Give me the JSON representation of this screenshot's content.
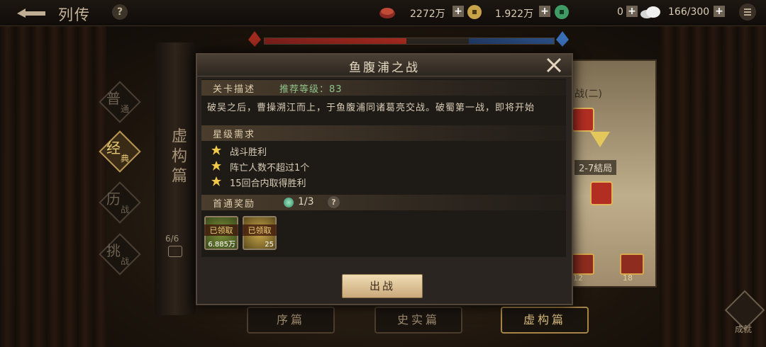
{
  "topbar": {
    "title": "列传",
    "help": "?",
    "copper": "2272万",
    "jade": "1.922万",
    "gems": "0",
    "stamina": "166/300"
  },
  "colors": {
    "accent": "#e7c875",
    "panel": "#2a2520",
    "button": "#e6cfa2"
  },
  "scroll": {
    "title": "虚构篇",
    "count": "6/6"
  },
  "categories": [
    {
      "t1": "普",
      "t2": "通"
    },
    {
      "t1": "经",
      "t2": "典"
    },
    {
      "t1": "历",
      "t2": "战"
    },
    {
      "t1": "挑",
      "t2": "战"
    }
  ],
  "map": {
    "title": "战(二)",
    "stage": "2-7結局",
    "chest1": "12",
    "chest2": "18"
  },
  "tabs": [
    "序篇",
    "史实篇",
    "虚构篇"
  ],
  "achievement": "成就",
  "dialog": {
    "title": "鱼腹浦之战",
    "desc_label": "关卡描述",
    "recommend": "推荐等级：83",
    "description": "破吴之后，曹操溯江而上，于鱼腹浦同诸葛亮交战。破蜀第一战，即将开始",
    "star_label": "星级需求",
    "conditions": [
      "战斗胜利",
      "阵亡人数不超过1个",
      "15回合内取得胜利"
    ],
    "reward_label": "首通奖励",
    "reward_count": "1/3",
    "reward_help": "?",
    "items": [
      {
        "status": "已领取",
        "qty": "6.885万"
      },
      {
        "status": "已领取",
        "qty": "25"
      }
    ],
    "fight": "出战"
  }
}
